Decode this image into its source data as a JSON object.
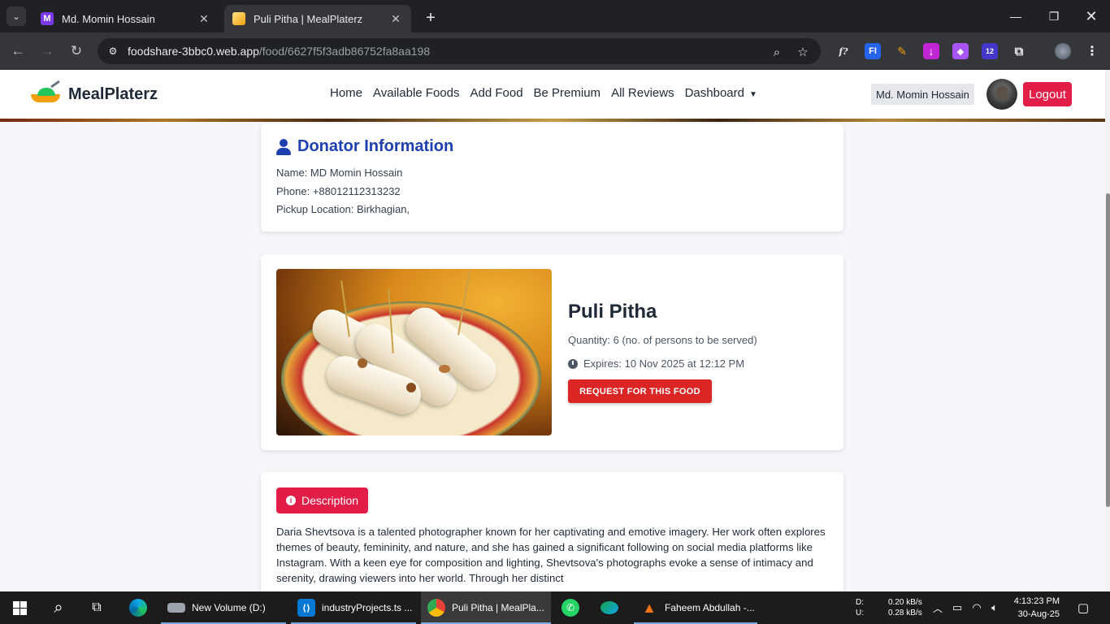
{
  "browser": {
    "tabs": [
      {
        "title": "Md. Momin Hossain",
        "favicon": "M",
        "favicon_color": "#7c3aed"
      },
      {
        "title": "Puli Pitha | MealPlaterz",
        "favicon": "",
        "favicon_color": "#f59e0b"
      }
    ],
    "url_host": "foodshare-3bbc0.web.app",
    "url_path": "/food/6627f5f3adb86752fa8aa198",
    "extension_badge": "12"
  },
  "site": {
    "logo_text": "MealPlaterz",
    "nav": [
      "Home",
      "Available Foods",
      "Add Food",
      "Be Premium",
      "All Reviews",
      "Dashboard"
    ],
    "user_name": "Md. Momin Hossain",
    "logout_label": "Logout"
  },
  "donor": {
    "heading": "Donator Information",
    "name_line": "Name: MD Momin Hossain",
    "phone_line": "Phone: +88012112313232",
    "location_line": "Pickup Location: Birkhagian,"
  },
  "food": {
    "name": "Puli Pitha",
    "quantity_line": "Quantity: 6 (no. of persons to be served)",
    "expires_label": "Expires:",
    "expires_value": "10 Nov 2025 at 12:12 PM",
    "request_button": "REQUEST FOR THIS FOOD"
  },
  "description": {
    "badge": "Description",
    "text": "Daria Shevtsova is a talented photographer known for her captivating and emotive imagery. Her work often explores themes of beauty, femininity, and nature, and she has gained a significant following on social media platforms like Instagram. With a keen eye for composition and lighting, Shevtsova's photographs evoke a sense of intimacy and serenity, drawing viewers into her world. Through her distinct"
  },
  "taskbar": {
    "apps": [
      "New Volume (D:)",
      "industryProjects.ts ...",
      "Puli Pitha | MealPla...",
      "Faheem Abdullah -..."
    ],
    "net_down_label": "D:",
    "net_up_label": "U:",
    "net_down": "0.20 kB/s",
    "net_up": "0.28 kB/s",
    "time": "4:13:23 PM",
    "date": "30-Aug-25"
  },
  "colors": {
    "accent_red": "#e11d48",
    "heading_blue": "#1e40af",
    "request_red": "#dc2626"
  }
}
